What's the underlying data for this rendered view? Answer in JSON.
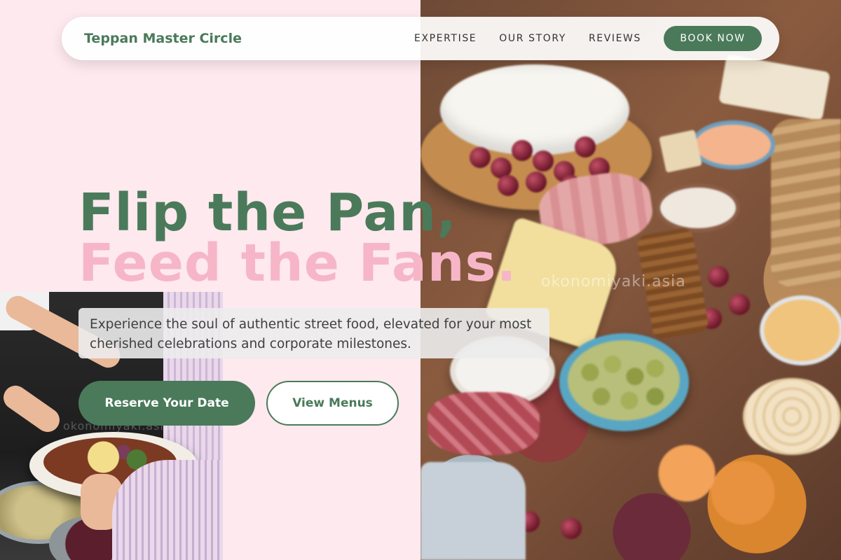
{
  "nav": {
    "brand": "Teppan Master Circle",
    "links": [
      "EXPERTISE",
      "OUR STORY",
      "REVIEWS"
    ],
    "cta": "BOOK NOW"
  },
  "hero": {
    "headline_line1": "Flip the Pan,",
    "headline_line2": "Feed the Fans.",
    "subtext": "Experience the soul of authentic street food, elevated for your most cherished celebrations and corporate milestones.",
    "primary_button": "Reserve Your Date",
    "secondary_button": "View Menus"
  },
  "images": {
    "hero_photo": "charcuterie-board-photo",
    "serve_photo": "plated-food-serving-photo",
    "hero_watermark": "okonomiyaki.asia",
    "serve_watermark": "okonomiyaki.asia"
  },
  "colors": {
    "brand_green": "#4a7a5a",
    "accent_pink": "#f6b6c8",
    "background": "#fde9ee"
  }
}
